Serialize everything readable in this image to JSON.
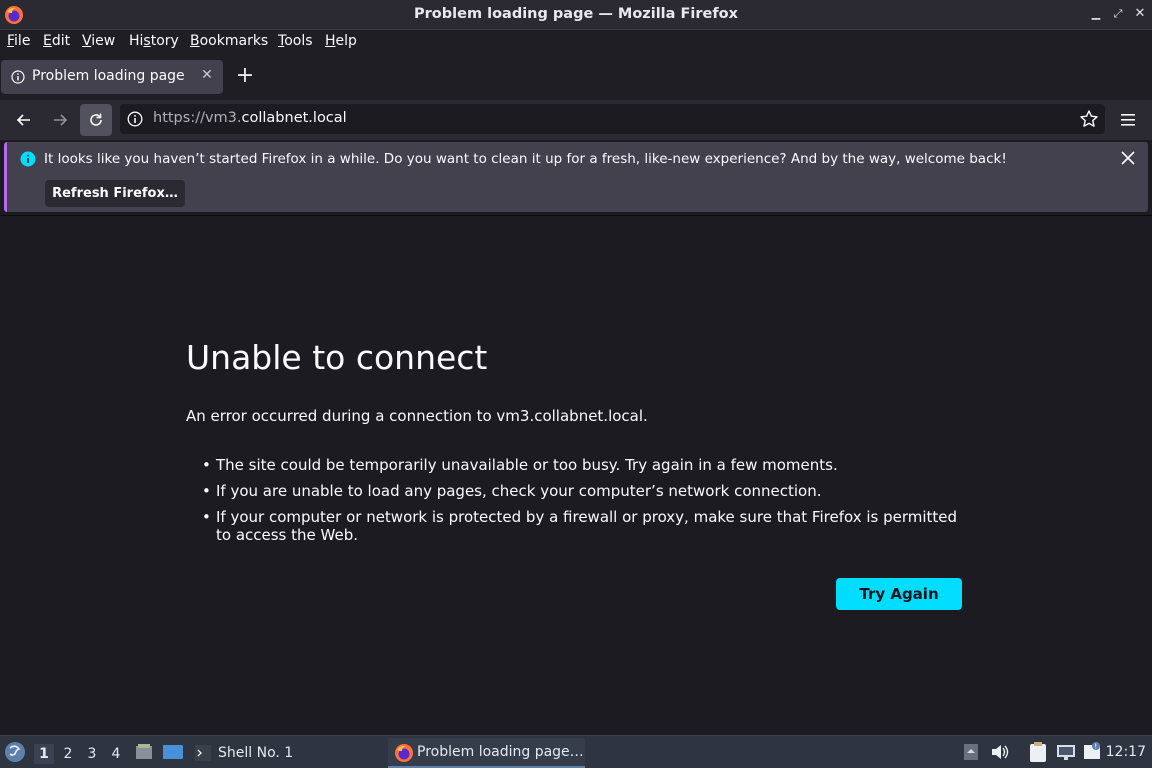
{
  "window": {
    "title": "Problem loading page — Mozilla Firefox",
    "controls": [
      "minimize",
      "maximize",
      "close"
    ]
  },
  "menubar": {
    "items": [
      {
        "label": "File",
        "accel": "F"
      },
      {
        "label": "Edit",
        "accel": "E"
      },
      {
        "label": "View",
        "accel": "V"
      },
      {
        "label": "History",
        "accel": "s"
      },
      {
        "label": "Bookmarks",
        "accel": "B"
      },
      {
        "label": "Tools",
        "accel": "T"
      },
      {
        "label": "Help",
        "accel": "H"
      }
    ]
  },
  "tabs": [
    {
      "label": "Problem loading page",
      "icon": "info-icon",
      "active": true
    }
  ],
  "toolbar": {
    "url_scheme": "https://vm3.",
    "url_host": "collabnet.local",
    "back_icon": "arrow-left-icon",
    "forward_icon": "arrow-right-icon",
    "reload_icon": "reload-icon",
    "bookmark_icon": "star-icon",
    "menu_icon": "hamburger-icon"
  },
  "notification": {
    "text": "It looks like you haven’t started Firefox in a while. Do you want to clean it up for a fresh, like-new experience? And by the way, welcome back!",
    "button_label": "Refresh Firefox…"
  },
  "error_page": {
    "title": "Unable to connect",
    "description": "An error occurred during a connection to vm3.collabnet.local.",
    "bullets": [
      "The site could be temporarily unavailable or too busy. Try again in a few moments.",
      "If you are unable to load any pages, check your computer’s network connection.",
      "If your computer or network is protected by a firewall or proxy, make sure that Firefox is permitted to access the Web."
    ],
    "try_again_label": "Try Again",
    "accent_color": "#00ddff"
  },
  "taskbar": {
    "workspaces": [
      "1",
      "2",
      "3",
      "4"
    ],
    "active_workspace": "1",
    "shell_label": "Shell No. 1",
    "firefox_task_label": "Problem loading page…",
    "clock": "12:17"
  }
}
